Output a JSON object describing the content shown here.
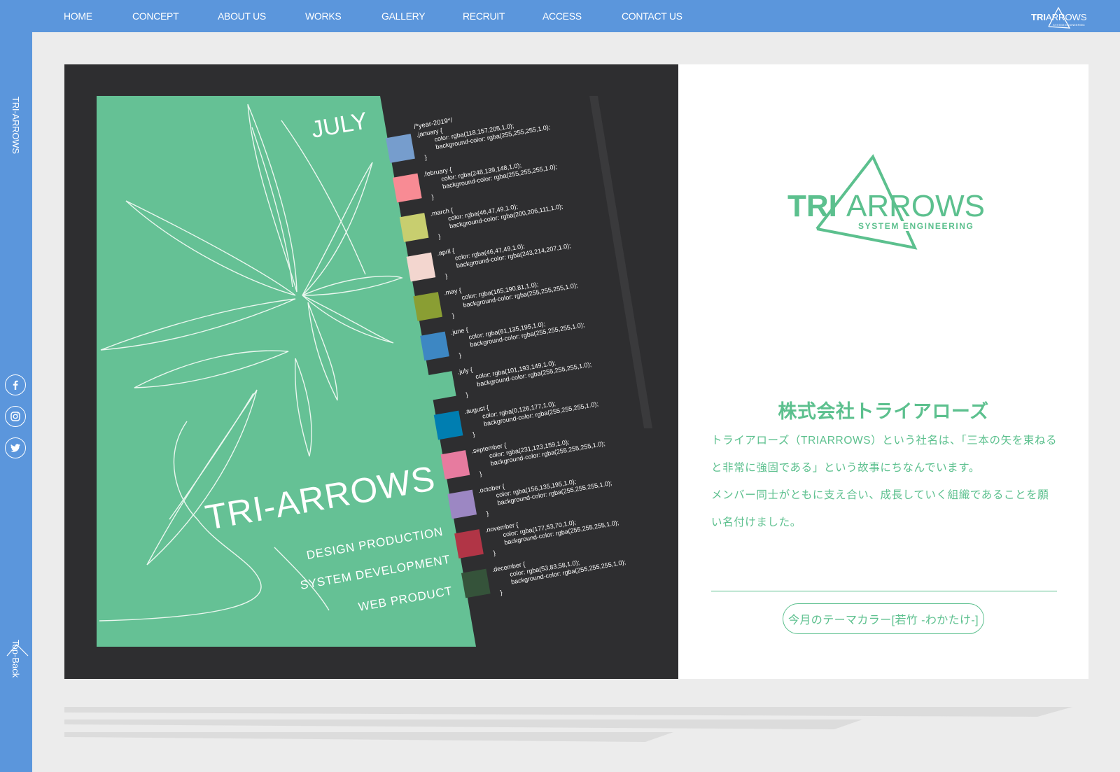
{
  "nav": {
    "items": [
      {
        "label": "HOME"
      },
      {
        "label": "CONCEPT"
      },
      {
        "label": "ABOUT US"
      },
      {
        "label": "WORKS"
      },
      {
        "label": "GALLERY"
      },
      {
        "label": "RECRUIT"
      },
      {
        "label": "ACCESS"
      },
      {
        "label": "CONTACT US"
      }
    ],
    "brand_logo": {
      "text_bold": "TRI",
      "text_light": "ARROWS",
      "subtext": "SYSTEM ENGINEERING"
    }
  },
  "sidebar": {
    "title": "TRI-ARROWS",
    "social": [
      {
        "icon": "facebook-icon"
      },
      {
        "icon": "instagram-icon"
      },
      {
        "icon": "twitter-icon"
      }
    ],
    "top_back": "Top-Back"
  },
  "poster": {
    "month": "JULY",
    "brand": "TRI-ARROWS",
    "services": [
      "DESIGN PRODUCTION",
      "SYSTEM DEVELOPMENT",
      "WEB PRODUCT"
    ],
    "code_header": "/*year-2019*/",
    "colors": [
      {
        "name": ".january {",
        "color": "color: rgba(118,157,205,1.0);",
        "bg": "background-color: rgba(255,255,255,1.0);",
        "swatch": "#769dcd"
      },
      {
        "name": ".february {",
        "color": "color: rgba(248,139,148,1.0);",
        "bg": "background-color: rgba(255,255,255,1.0);",
        "swatch": "#f88b94"
      },
      {
        "name": ".march {",
        "color": "color: rgba(46,47,49,1.0);",
        "bg": "background-color: rgba(200,206,111,1.0);",
        "swatch": "#c8ce6f"
      },
      {
        "name": ".april {",
        "color": "color: rgba(46,47,49,1.0);",
        "bg": "background-color: rgba(243,214,207,1.0);",
        "swatch": "#f3d6cf"
      },
      {
        "name": ".may {",
        "color": "color: rgba(165,190,81,1.0);",
        "bg": "background-color: rgba(255,255,255,1.0);",
        "swatch": "#8a9e33"
      },
      {
        "name": ".june {",
        "color": "color: rgba(61,135,195,1.0);",
        "bg": "background-color: rgba(255,255,255,1.0);",
        "swatch": "#3d87c3"
      },
      {
        "name": ".july {",
        "color": "color: rgba(101,193,149,1.0);",
        "bg": "background-color: rgba(255,255,255,1.0);",
        "swatch": "#65c195"
      },
      {
        "name": ".august {",
        "color": "color: rgba(0,126,177,1.0);",
        "bg": "background-color: rgba(255,255,255,1.0);",
        "swatch": "#007eb1"
      },
      {
        "name": ".september {",
        "color": "color: rgba(231,123,159,1.0);",
        "bg": "background-color: rgba(255,255,255,1.0);",
        "swatch": "#e77b9f"
      },
      {
        "name": ".october {",
        "color": "color: rgba(156,135,195,1.0);",
        "bg": "background-color: rgba(255,255,255,1.0);",
        "swatch": "#9c87c3"
      },
      {
        "name": ".november {",
        "color": "color: rgba(177,53,70,1.0);",
        "bg": "background-color: rgba(255,255,255,1.0);",
        "swatch": "#b13546"
      },
      {
        "name": ".december {",
        "color": "color: rgba(53,83,58,1.0);",
        "bg": "background-color: rgba(255,255,255,1.0);",
        "swatch": "#35533a"
      }
    ],
    "close_brace": "}"
  },
  "info": {
    "logo": {
      "text_bold": "TRI",
      "text_light": "ARROWS",
      "subtext": "SYSTEM ENGINEERING"
    },
    "company_name": "株式会社トライアローズ",
    "description": [
      "トライアローズ（TRIARROWS）という社名は、「三本の矢を束ねる",
      "と非常に強固である」という故事にちなんでいます。",
      "メンバー同士がともに支え合い、成長していく組織であることを願",
      "い名付けました。"
    ],
    "theme_button": "今月のテーマカラー[若竹 -わかたけ-]"
  },
  "colors": {
    "nav_blue": "#5b96dc",
    "accent_green": "#5cc08e",
    "poster_green": "#65c195",
    "poster_dark": "#2e2e30",
    "page_gray": "#ececec"
  }
}
